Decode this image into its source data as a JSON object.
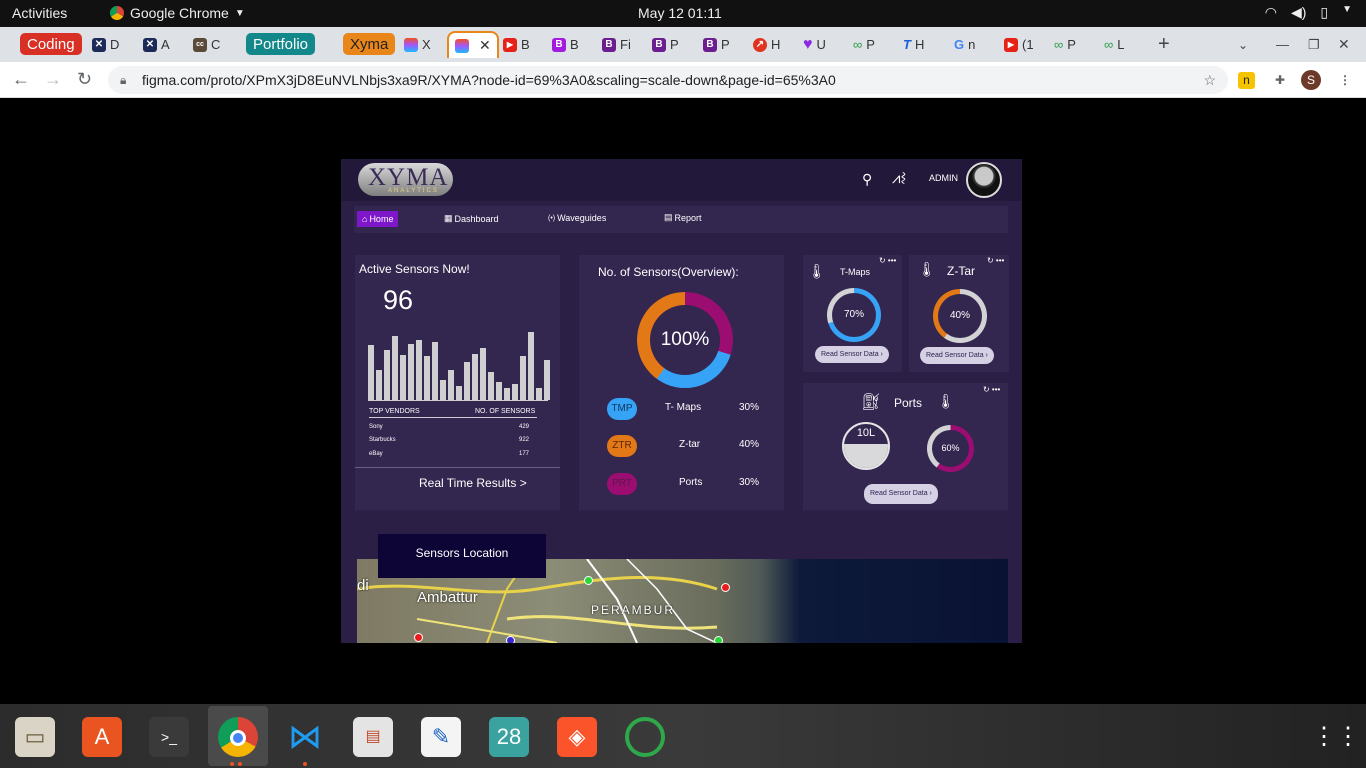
{
  "system": {
    "activities": "Activities",
    "app_name": "Google Chrome",
    "clock": "May 12  01:11"
  },
  "tabs": {
    "groups": [
      {
        "label": "Coding",
        "color": "#d93025"
      },
      {
        "label": "Portfolio",
        "color": "#12888a"
      },
      {
        "label": "Xyma",
        "color": "#e8861a"
      }
    ],
    "items": [
      {
        "label": "D",
        "icon": "x-app-icon",
        "icon_color": "#1b2a57"
      },
      {
        "label": "A",
        "icon": "x-app-icon",
        "icon_color": "#1b2a57"
      },
      {
        "label": "C",
        "icon": "cc-icon",
        "icon_color": "#5a4a3a"
      },
      {
        "label": "X",
        "icon": "figma-icon",
        "icon_color": "#a259ff"
      },
      {
        "label": "B",
        "icon": "youtube-icon",
        "icon_color": "#e62117"
      },
      {
        "label": "B",
        "icon": "b-icon",
        "icon_color": "#a21ce0"
      },
      {
        "label": "B",
        "icon": "b-icon",
        "icon_color": "#6b1f8f"
      },
      {
        "label": "Fi",
        "icon": "b-icon",
        "icon_color": "#6b1f8f"
      },
      {
        "label": "P",
        "icon": "b-icon",
        "icon_color": "#6b1f8f"
      },
      {
        "label": "P",
        "icon": "b-icon",
        "icon_color": "#6b1f8f"
      },
      {
        "label": "H",
        "icon": "compass-icon",
        "icon_color": "#e0341f"
      },
      {
        "label": "U",
        "icon": "heart-icon",
        "icon_color": "#8a2be2"
      },
      {
        "label": "P",
        "icon": "infinity-icon",
        "icon_color": "#2e9d48"
      },
      {
        "label": "H",
        "icon": "t-icon",
        "icon_color": "#1a5fd6"
      },
      {
        "label": "n",
        "icon": "google-icon",
        "icon_color": "#4285f4"
      },
      {
        "label": "(1",
        "icon": "youtube-icon",
        "icon_color": "#e62117"
      },
      {
        "label": "P",
        "icon": "infinity-icon",
        "icon_color": "#2e9d48"
      },
      {
        "label": "L",
        "icon": "infinity-icon",
        "icon_color": "#2e9d48"
      }
    ],
    "new_tab": "+"
  },
  "toolbar": {
    "url": "figma.com/proto/XPmX3jD8EuNVLNbjs3xa9R/XYMA?node-id=69%3A0&scaling=scale-down&page-id=65%3A0",
    "profile_initial": "S"
  },
  "dashboard": {
    "logo_text": "XYMA",
    "logo_sub": "ANALYTICS",
    "admin_label": "ADMIN",
    "nav": {
      "home": "Home",
      "dashboard": "Dashboard",
      "waveguides": "Waveguides",
      "report": "Report"
    },
    "active_sensors": {
      "title": "Active Sensors Now!",
      "count": "96",
      "col_vendor": "TOP VENDORS",
      "col_sensors": "NO. OF SENSORS",
      "rows": [
        {
          "vendor": "Sony",
          "count": "429"
        },
        {
          "vendor": "Starbucks",
          "count": "922"
        },
        {
          "vendor": "eBay",
          "count": "177"
        }
      ],
      "link": "Real Time Results  >"
    },
    "overview": {
      "title": "No. of Sensors(Overview):",
      "center": "100%",
      "legend": [
        {
          "code": "TMP",
          "name": "T- Maps",
          "pct": "30%",
          "color": "#36a3f7"
        },
        {
          "code": "ZTR",
          "name": "Z-tar",
          "pct": "40%",
          "color": "#e27816"
        },
        {
          "code": "PRT",
          "name": "Ports",
          "pct": "30%",
          "color": "#9b0d71"
        }
      ]
    },
    "tmaps": {
      "title": "T-Maps",
      "pct": "70%",
      "btn": "Read Sensor Data"
    },
    "ztar": {
      "title": "Z-Tar",
      "pct": "40%",
      "btn": "Read Sensor Data"
    },
    "ports": {
      "title": "Ports",
      "tank": "10L",
      "pct": "60%",
      "btn": "Read Sensor Data"
    },
    "map": {
      "button": "Sensors Location",
      "label_a": "Ambattur",
      "label_b": "PERAMBUR",
      "label_c": "di"
    }
  }
}
